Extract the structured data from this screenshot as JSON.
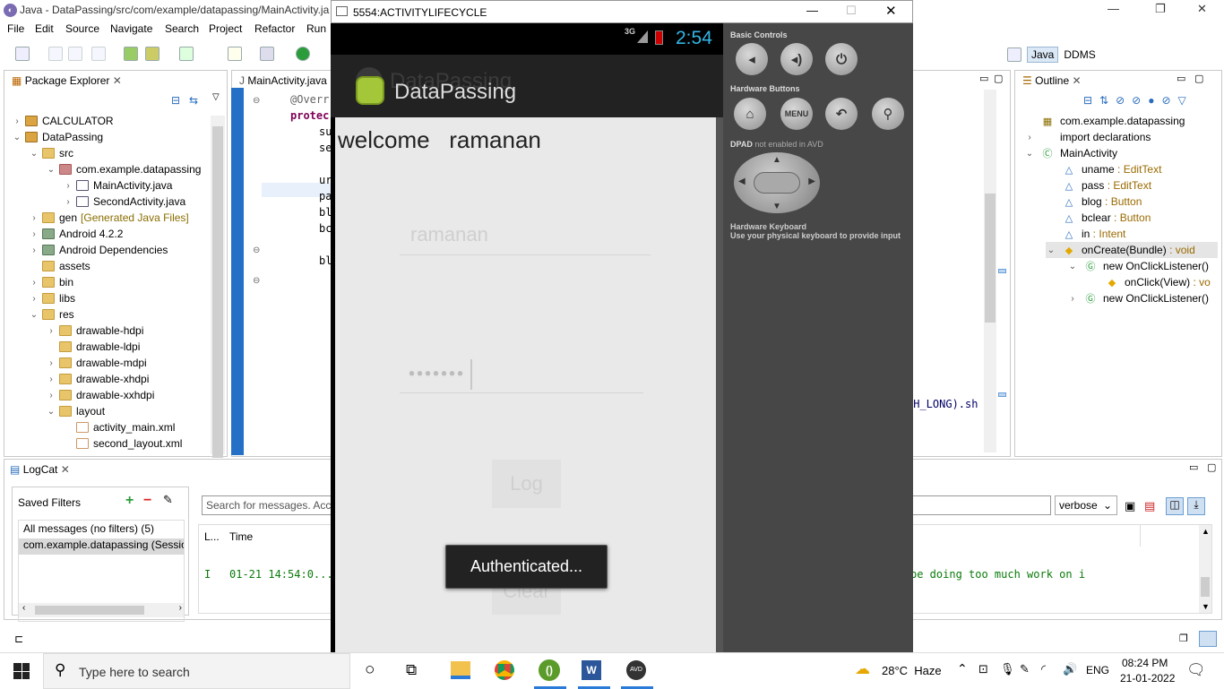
{
  "window": {
    "title": "Java - DataPassing/src/com/example/datapassing/MainActivity.ja",
    "minimize": "—",
    "restore": "❐",
    "close": "✕"
  },
  "menu": [
    "File",
    "Edit",
    "Source",
    "Navigate",
    "Search",
    "Project",
    "Refactor",
    "Run"
  ],
  "perspectives": {
    "java": "Java",
    "ddms": "DDMS"
  },
  "package_explorer": {
    "tab": "Package Explorer",
    "items": [
      {
        "label": "CALCULATOR",
        "level": 0,
        "tw": "›",
        "icon": "proj"
      },
      {
        "label": "DataPassing",
        "level": 0,
        "tw": "⌄",
        "icon": "proj"
      },
      {
        "label": "src",
        "level": 1,
        "tw": "⌄",
        "icon": "folder"
      },
      {
        "label": "com.example.datapassing",
        "level": 2,
        "tw": "⌄",
        "icon": "pkg"
      },
      {
        "label": "MainActivity.java",
        "level": 3,
        "tw": "›",
        "icon": "jfile"
      },
      {
        "label": "SecondActivity.java",
        "level": 3,
        "tw": "›",
        "icon": "jfile"
      },
      {
        "label": "gen",
        "level": 1,
        "tw": "›",
        "icon": "folder",
        "suffix": "[Generated Java Files]"
      },
      {
        "label": "Android 4.2.2",
        "level": 1,
        "tw": "›",
        "icon": "lib"
      },
      {
        "label": "Android Dependencies",
        "level": 1,
        "tw": "›",
        "icon": "lib"
      },
      {
        "label": "assets",
        "level": 1,
        "tw": "",
        "icon": "folder"
      },
      {
        "label": "bin",
        "level": 1,
        "tw": "›",
        "icon": "folder"
      },
      {
        "label": "libs",
        "level": 1,
        "tw": "›",
        "icon": "folder"
      },
      {
        "label": "res",
        "level": 1,
        "tw": "⌄",
        "icon": "folder"
      },
      {
        "label": "drawable-hdpi",
        "level": 2,
        "tw": "›",
        "icon": "folder"
      },
      {
        "label": "drawable-ldpi",
        "level": 2,
        "tw": "",
        "icon": "folder"
      },
      {
        "label": "drawable-mdpi",
        "level": 2,
        "tw": "›",
        "icon": "folder"
      },
      {
        "label": "drawable-xhdpi",
        "level": 2,
        "tw": "›",
        "icon": "folder"
      },
      {
        "label": "drawable-xxhdpi",
        "level": 2,
        "tw": "›",
        "icon": "folder"
      },
      {
        "label": "layout",
        "level": 2,
        "tw": "⌄",
        "icon": "folder"
      },
      {
        "label": "activity_main.xml",
        "level": 3,
        "tw": "",
        "icon": "xml"
      },
      {
        "label": "second_layout.xml",
        "level": 3,
        "tw": "",
        "icon": "xml"
      }
    ]
  },
  "editor": {
    "tab": "MainActivity.java",
    "lines": [
      "@Overr",
      "protec",
      "su",
      "se",
      "",
      "ur",
      "pa",
      "bl",
      "bc",
      "",
      "bl"
    ],
    "right_code": "TH_LONG).sh"
  },
  "emulator": {
    "title": "5554:ACTIVITYLIFECYCLE",
    "network": "3G",
    "time": "2:54",
    "app_title": "DataPassing",
    "ghost_title": "DataPassing",
    "welcome": "welcome",
    "username": "ramanan",
    "username_field": "ramanan",
    "password_dots": "•••••••",
    "log_button": "Log",
    "clear_button": "Clear",
    "toast": "Authenticated..."
  },
  "controls": {
    "basic": "Basic Controls",
    "hardware": "Hardware Buttons",
    "menu_label": "MENU",
    "dpad": "DPAD",
    "dpad_note": "not enabled in AVD",
    "kbd_title": "Hardware Keyboard",
    "kbd_note": "Use your physical keyboard to provide input"
  },
  "outline": {
    "tab": "Outline",
    "items": [
      {
        "name": "com.example.datapassing",
        "type": "",
        "level": 0,
        "tw": "",
        "icon": "pkg-icon"
      },
      {
        "name": "import declarations",
        "type": "",
        "level": 0,
        "tw": "›",
        "icon": "import-icon"
      },
      {
        "name": "MainActivity",
        "type": "",
        "level": 0,
        "tw": "⌄",
        "icon": "class-icon"
      },
      {
        "name": "uname",
        "type": "EditText",
        "level": 1,
        "tw": "",
        "icon": "field-icon"
      },
      {
        "name": "pass",
        "type": "EditText",
        "level": 1,
        "tw": "",
        "icon": "field-icon"
      },
      {
        "name": "blog",
        "type": "Button",
        "level": 1,
        "tw": "",
        "icon": "field-icon"
      },
      {
        "name": "bclear",
        "type": "Button",
        "level": 1,
        "tw": "",
        "icon": "field-icon"
      },
      {
        "name": "in",
        "type": "Intent",
        "level": 1,
        "tw": "",
        "icon": "field-icon"
      },
      {
        "name": "onCreate(Bundle)",
        "type": "void",
        "level": 1,
        "tw": "⌄",
        "icon": "method-icon",
        "selected": true
      },
      {
        "name": "new OnClickListener()",
        "type": "",
        "level": 2,
        "tw": "⌄",
        "icon": "anon-class-icon"
      },
      {
        "name": "onClick(View)",
        "type": "vo",
        "level": 3,
        "tw": "",
        "icon": "method-icon"
      },
      {
        "name": "new OnClickListener()",
        "type": "",
        "level": 2,
        "tw": "›",
        "icon": "anon-class-icon"
      }
    ]
  },
  "logcat": {
    "tab": "LogCat",
    "saved_filters": "Saved Filters",
    "filters": [
      "All messages (no filters) (5)",
      "com.example.datapassing (Session"
    ],
    "search_placeholder": "Search for messages. Acce",
    "level": "verbose",
    "col_level": "L...",
    "col_time": "Time",
    "row_level": "I",
    "row_time": "01-21 14:54:0...",
    "row_msg": "be doing too much work on i"
  },
  "taskbar": {
    "search_placeholder": "Type here to search",
    "weather": "28°C  Haze",
    "lang": "ENG",
    "time": "08:24 PM",
    "date": "21-01-2022"
  }
}
